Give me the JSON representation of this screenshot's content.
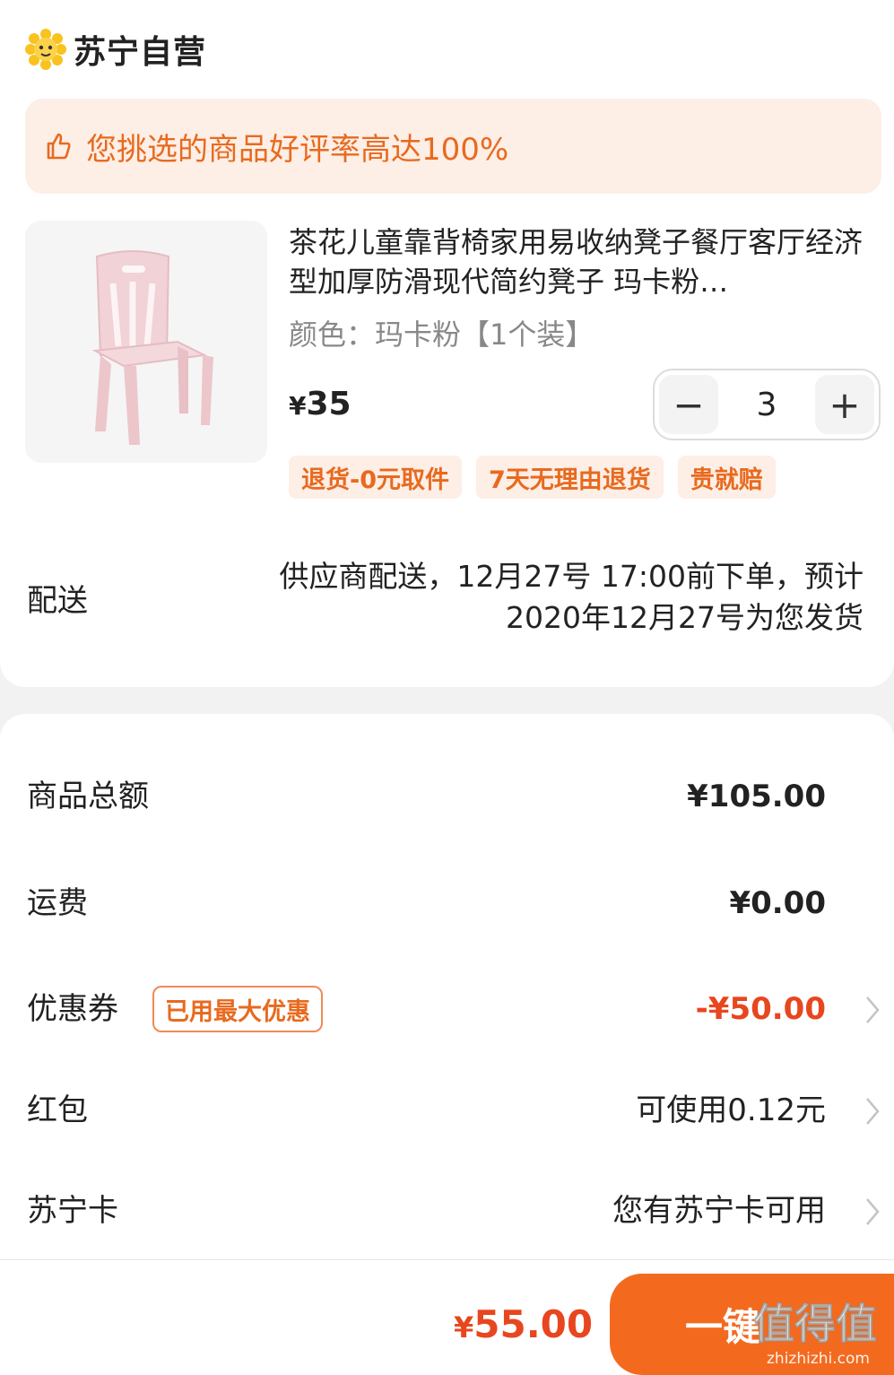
{
  "store": {
    "name": "苏宁自营",
    "logo_icon": "lion-logo-icon"
  },
  "notice": {
    "text": "您挑选的商品好评率高达100%",
    "icon": "thumbs-up-icon"
  },
  "product": {
    "title": "茶花儿童靠背椅家用易收纳凳子餐厅客厅经济型加厚防滑现代简约凳子 玛卡粉…",
    "spec": "颜色：玛卡粉【1个装】",
    "price_symbol": "¥",
    "price": "35",
    "quantity": "3",
    "minus_label": "−",
    "plus_label": "+",
    "tags": [
      "退货-0元取件",
      "7天无理由退货",
      "贵就赔"
    ]
  },
  "delivery": {
    "label": "配送",
    "text_line1": "供应商配送，12月27号 17:00前下单，预计",
    "text_line2": "2020年12月27号为您发货"
  },
  "summary": {
    "goods_total_label": "商品总额",
    "goods_total_value": "¥105.00",
    "shipping_label": "运费",
    "shipping_value": "¥0.00",
    "coupon_label": "优惠券",
    "coupon_badge": "已用最大优惠",
    "coupon_value": "-¥50.00",
    "redpacket_label": "红包",
    "redpacket_value": "可使用0.12元",
    "card_label": "苏宁卡",
    "card_value": "您有苏宁卡可用"
  },
  "footer": {
    "total_symbol": "¥",
    "total_value": "55.00",
    "submit_label": "一键",
    "watermark": "值得值",
    "watermark_sub": "zhizhizhi.com"
  },
  "colors": {
    "accent": "#f36a1f",
    "accent_text": "#e86a1e",
    "price_red": "#e8461e",
    "notice_bg": "#fdeee6"
  }
}
